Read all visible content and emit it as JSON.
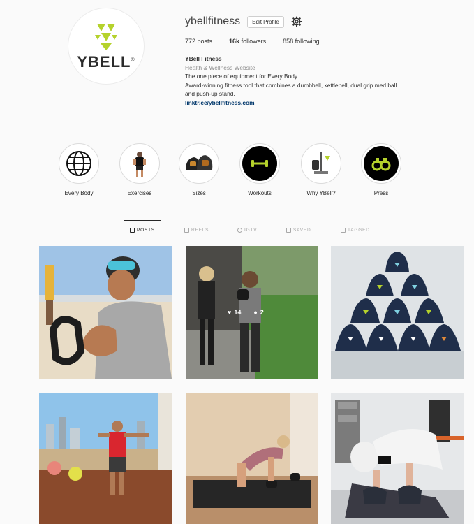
{
  "profile": {
    "username": "ybellfitness",
    "edit_label": "Edit Profile",
    "logo_text": "YBELL",
    "posts": "772 posts",
    "followers_count": "16k",
    "followers_label": "followers",
    "following": "858 following",
    "name": "YBell Fitness",
    "category": "Health & Wellness Website",
    "bio_line1": "The one piece of equipment for Every Body.",
    "bio_line2": "Award-winning fitness tool that combines a dumbbell, kettlebell, dual grip med ball",
    "bio_line3": "and push-up stand.",
    "link": "linktr.ee/ybellfitness.com"
  },
  "highlights": [
    {
      "label": "Every Body",
      "icon": "globe-icon"
    },
    {
      "label": "Exercises",
      "icon": "person-photo"
    },
    {
      "label": "Sizes",
      "icon": "ybell-sizes-photo"
    },
    {
      "label": "Workouts",
      "icon": "dumbbell-icon"
    },
    {
      "label": "Why YBell?",
      "icon": "award-photo"
    },
    {
      "label": "Press",
      "icon": "binoculars-icon"
    }
  ],
  "tabs": [
    {
      "label": "POSTS",
      "active": true
    },
    {
      "label": "REELS",
      "active": false
    },
    {
      "label": "IGTV",
      "active": false
    },
    {
      "label": "SAVED",
      "active": false
    },
    {
      "label": "TAGGED",
      "active": false
    }
  ],
  "post2_overlay": {
    "likes": "14",
    "comments": "2"
  },
  "colors": {
    "brand_green": "#b5d22c",
    "link": "#00376b",
    "navy": "#1f2e4a"
  }
}
